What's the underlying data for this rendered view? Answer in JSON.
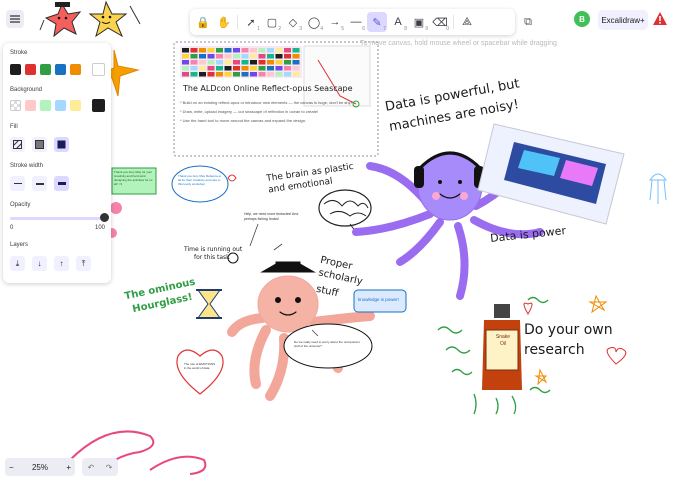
{
  "toolbar": {
    "tools": [
      {
        "name": "lock-tool",
        "glyph": "🔒",
        "num": ""
      },
      {
        "name": "hand-tool",
        "glyph": "✋",
        "num": ""
      },
      {
        "name": "selection-tool",
        "glyph": "➚",
        "num": "1"
      },
      {
        "name": "rectangle-tool",
        "glyph": "▢",
        "num": "2"
      },
      {
        "name": "diamond-tool",
        "glyph": "◇",
        "num": "3"
      },
      {
        "name": "ellipse-tool",
        "glyph": "◯",
        "num": "4"
      },
      {
        "name": "arrow-tool",
        "glyph": "→",
        "num": "5"
      },
      {
        "name": "line-tool",
        "glyph": "—",
        "num": "6"
      },
      {
        "name": "draw-tool",
        "glyph": "✎",
        "num": "7"
      },
      {
        "name": "text-tool",
        "glyph": "A",
        "num": "8"
      },
      {
        "name": "image-tool",
        "glyph": "▣",
        "num": "9"
      },
      {
        "name": "eraser-tool",
        "glyph": "⌫",
        "num": "0"
      },
      {
        "name": "shapes-tool",
        "glyph": "⟁",
        "num": ""
      }
    ],
    "active_tool": "draw-tool",
    "extra_glyph": "⧉",
    "hint": "To move canvas, hold mouse wheel or spacebar while dragging"
  },
  "header": {
    "avatar": "B",
    "plus_label": "Excalidraw+",
    "alert_color": "#e03131"
  },
  "panel": {
    "stroke_label": "Stroke",
    "stroke_colors": [
      "#1e1e1e",
      "#e03131",
      "#2f9e44",
      "#1971c2",
      "#f08c00"
    ],
    "stroke_current": "#ffffff",
    "background_label": "Background",
    "background_colors": [
      "transparent",
      "#ffc9c9",
      "#b2f2bb",
      "#a5d8ff",
      "#ffec99"
    ],
    "background_current": "#1e1e1e",
    "fill_label": "Fill",
    "stroke_width_label": "Stroke width",
    "opacity_label": "Opacity",
    "opacity_min": "0",
    "opacity_max": "100",
    "opacity_value": 1.0,
    "layers_label": "Layers",
    "layer_glyphs": [
      "⤓",
      "↓",
      "↑",
      "⤒"
    ]
  },
  "zoom": {
    "minus": "−",
    "value": "25%",
    "plus": "+"
  },
  "history": {
    "undo": "↶",
    "redo": "↷"
  },
  "canvas": {
    "card_title": "The ALDcon Online Reflect-opus Seascape",
    "card_lines": [
      "* Build on an existing reflect-opus or introduce new elements — the canvas is huge, don't be shy!",
      "* Draw, write, upload imagery — our seascape of reflection in ocean to create!",
      "* Use the hand tool to move around the canvas and expand the design."
    ],
    "data_powerful": "Data is powerful, but",
    "machines_noisy": "machines are noisy!",
    "data_is_power": "Data is power",
    "brain_text_1": "The brain as plastic",
    "brain_text_2": "and emotional",
    "proper_1": "Proper",
    "proper_2": "scholarly",
    "proper_3": "stuff",
    "knowledge_box": "knowledge is power!",
    "time_1": "Time is running out",
    "time_2": "for this task",
    "ominous_1": "The ominous",
    "ominous_2": "Hourglass!",
    "dyor_1": "Do your own",
    "dyor_2": "research",
    "snake_oil_1": "Snake",
    "snake_oil_2": "Oil",
    "sticky_note": "Thank you Amy May for your creativity and hard work designing the activities for us all! <3",
    "bubble_note": "Thank you Amy May Rebecca et all for their creativity and care in this lovely workshop",
    "small_note": "Help, we need more tentacles! And perhaps fishing hooks!",
    "heart_note": "The role of EMOTIONS in the world of data",
    "oval_note": "Do we really need to worry about the unimportant stuff of the universe?"
  }
}
